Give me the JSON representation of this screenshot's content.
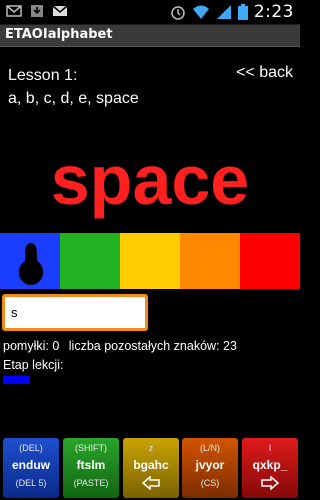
{
  "status_bar": {
    "time": "2:23",
    "left_icons": [
      "mail-icon",
      "download-icon",
      "gmail-icon"
    ],
    "right_icons": [
      "alarm-icon",
      "wifi-icon",
      "signal-icon",
      "battery-icon"
    ]
  },
  "app": {
    "title": "ETAOIalphabet"
  },
  "lesson": {
    "title": "Lesson 1:",
    "letters": "a, b, c, d, e, space",
    "back_label": "<< back"
  },
  "current_letter": "space",
  "colors": {
    "letter": "#ff2020",
    "bar": [
      "#1a3dff",
      "#22b222",
      "#ffcc00",
      "#ff8800",
      "#ff0000"
    ],
    "input_border": "#f28c1e",
    "progress": "#0000ff"
  },
  "input": {
    "value": "s"
  },
  "stats": {
    "errors_label": "pomyłki:",
    "errors": "0",
    "remaining_label": "liczba pozostałych znaków:",
    "remaining": "23"
  },
  "stage": {
    "label": "Etap lekcji:",
    "progress_fraction": 0.1
  },
  "keys": [
    {
      "top": "(DEL)",
      "main": "enduw",
      "bottom": "(DEL 5)"
    },
    {
      "top": "(SHIFT)",
      "main": "ftslm",
      "bottom": "(PASTE)"
    },
    {
      "top": "z",
      "main": "bgahc",
      "bottom": ""
    },
    {
      "top": "(L/N)",
      "main": "jvyor",
      "bottom": "(CS)"
    },
    {
      "top": "l",
      "main": "qxkp_",
      "bottom": ""
    }
  ]
}
